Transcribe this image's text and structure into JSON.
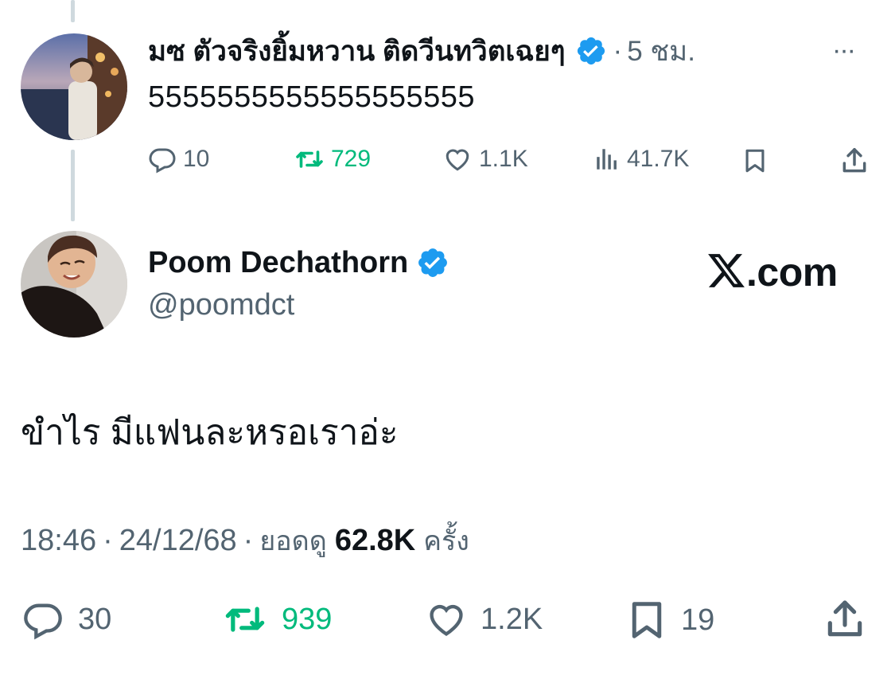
{
  "parent_tweet": {
    "display_name": "มซ ตัวจริงยิ้มหวาน ติดวีนทวิตเฉยๆ",
    "separator": "·",
    "time": "5 ชม.",
    "more": "···",
    "text": "5555555555555555555",
    "stats": {
      "replies": "10",
      "reposts": "729",
      "likes": "1.1K",
      "views": "41.7K"
    }
  },
  "main_tweet": {
    "display_name": "Poom Dechathorn",
    "handle": "@poomdct",
    "watermark": ".com",
    "text": "ขำไร มีแฟนละหรอเราอ่ะ",
    "meta": {
      "time": "18:46",
      "sep1": "·",
      "date": "24/12/68",
      "sep2": "·",
      "views_label": "ยอดดู",
      "views_count": "62.8K",
      "views_suffix": "ครั้ง"
    },
    "stats": {
      "replies": "30",
      "reposts": "939",
      "likes": "1.2K",
      "bookmarks": "19"
    }
  },
  "colors": {
    "verified": "#1d9bf0",
    "repost": "#00ba7c",
    "secondary_text": "#536471",
    "primary_text": "#0f1419"
  }
}
